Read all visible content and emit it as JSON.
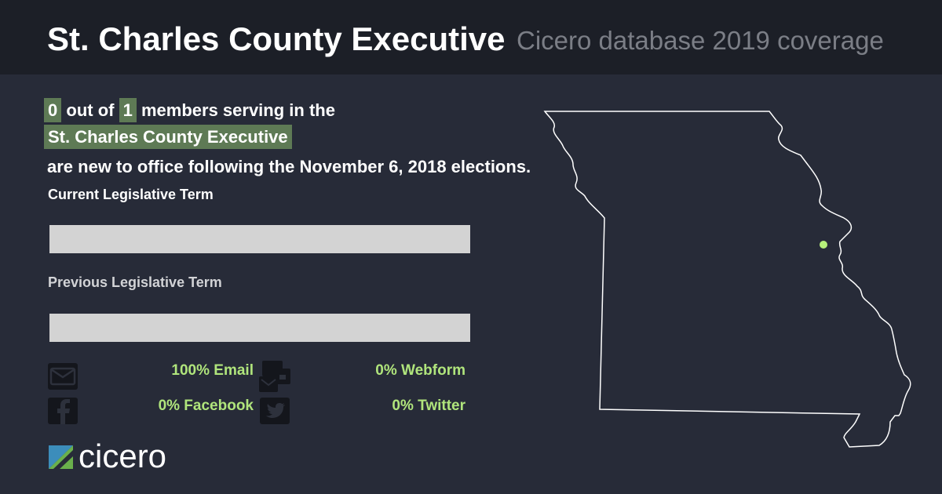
{
  "header": {
    "title": "St. Charles County Executive",
    "subtitle": "Cicero database 2019 coverage"
  },
  "statement": {
    "new_count": "0",
    "out_of_text": "out of",
    "total_count": "1",
    "members_text": "members serving in the",
    "body_name": "St. Charles County Executive",
    "closing_text": "are new to office following the November 6, 2018 elections."
  },
  "terms": {
    "current_label": "Current Legislative Term",
    "current_fill": 0,
    "previous_label": "Previous Legislative Term",
    "previous_fill": 0
  },
  "stats": {
    "email": "100% Email",
    "webform": "0% Webform",
    "facebook": "0% Facebook",
    "twitter": "0% Twitter"
  },
  "icons": {
    "email": "envelope-icon",
    "webform": "webform-icon",
    "facebook": "facebook-icon",
    "twitter": "twitter-icon",
    "logo": "cicero-logo"
  },
  "logo": {
    "text": "cicero"
  },
  "colors": {
    "background": "#272b38",
    "header": "#1c1f27",
    "highlight": "#5e7a55",
    "stat_text": "#b0e57c",
    "bar": "#d3d3d3",
    "marker": "#b6f07a"
  }
}
